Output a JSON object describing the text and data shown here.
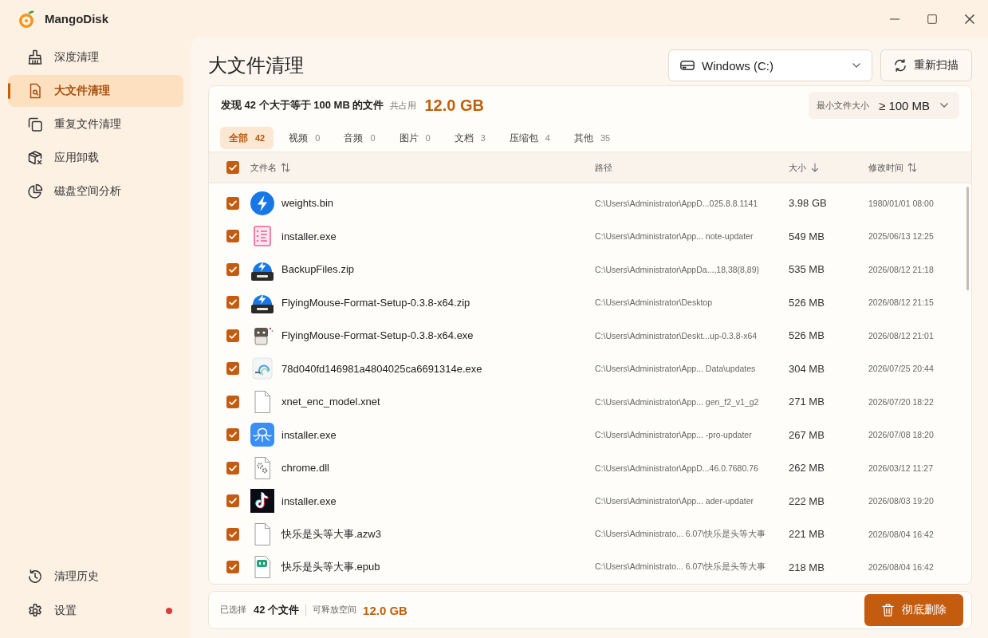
{
  "window": {
    "title": "MangoDisk"
  },
  "sidebar": {
    "items": [
      {
        "label": "深度清理",
        "selected": false
      },
      {
        "label": "大文件清理",
        "selected": true
      },
      {
        "label": "重复文件清理",
        "selected": false
      },
      {
        "label": "应用卸载",
        "selected": false
      },
      {
        "label": "磁盘空间分析",
        "selected": false
      }
    ],
    "bottom_items": [
      {
        "label": "清理历史",
        "notification": false
      },
      {
        "label": "设置",
        "notification": true
      }
    ]
  },
  "page": {
    "title": "大文件清理",
    "drive_select": {
      "value": "Windows (C:)"
    },
    "rescan_button": "重新扫描"
  },
  "summary": {
    "text": "发现 42 个大于等于 100 MB 的文件",
    "total_label": "共占用",
    "total": "12.0 GB",
    "min_size": {
      "label": "最小文件大小",
      "value": "≥ 100 MB"
    }
  },
  "tabs": [
    {
      "label": "全部",
      "count": "42",
      "selected": true
    },
    {
      "label": "视频",
      "count": "0",
      "selected": false
    },
    {
      "label": "音频",
      "count": "0",
      "selected": false
    },
    {
      "label": "图片",
      "count": "0",
      "selected": false
    },
    {
      "label": "文档",
      "count": "3",
      "selected": false
    },
    {
      "label": "压缩包",
      "count": "4",
      "selected": false
    },
    {
      "label": "其他",
      "count": "35",
      "selected": false
    }
  ],
  "table": {
    "all_checked": true,
    "columns": [
      {
        "label": "文件名",
        "sorted": false
      },
      {
        "label": "路径"
      },
      {
        "label": "大小",
        "sorted": true
      },
      {
        "label": "修改时间",
        "sorted": false
      }
    ],
    "rows": [
      {
        "checked": true,
        "name": "weights.bin",
        "path": "C:\\Users\\Administrator\\AppD...025.8.8.1141",
        "size": "3.98 GB",
        "modified": "1980/01/01 08:00"
      },
      {
        "checked": true,
        "name": "installer.exe",
        "path": "C:\\Users\\Administrator\\App... note-updater",
        "size": "549 MB",
        "modified": "2025/06/13 12:25"
      },
      {
        "checked": true,
        "name": "BackupFiles.zip",
        "path": "C:\\Users\\Administrator\\AppDa...,18,38(8,89)",
        "size": "535 MB",
        "modified": "2026/08/12 21:18"
      },
      {
        "checked": true,
        "name": "FlyingMouse-Format-Setup-0.3.8-x64.zip",
        "path": "C:\\Users\\Administrator\\Desktop",
        "size": "526 MB",
        "modified": "2026/08/12 21:15"
      },
      {
        "checked": true,
        "name": "FlyingMouse-Format-Setup-0.3.8-x64.exe",
        "path": "C:\\Users\\Administrator\\Deskt...up-0.3.8-x64",
        "size": "526 MB",
        "modified": "2026/08/12 21:01"
      },
      {
        "checked": true,
        "name": "78d040fd146981a4804025ca6691314e.exe",
        "path": "C:\\Users\\Administrator\\App... Data\\updates",
        "size": "304 MB",
        "modified": "2026/07/25 20:44"
      },
      {
        "checked": true,
        "name": "xnet_enc_model.xnet",
        "path": "C:\\Users\\Administrator\\App... gen_f2_v1_g2",
        "size": "271 MB",
        "modified": "2026/07/20 18:22"
      },
      {
        "checked": true,
        "name": "installer.exe",
        "path": "C:\\Users\\Administrator\\App... -pro-updater",
        "size": "267 MB",
        "modified": "2026/07/08 18:20"
      },
      {
        "checked": true,
        "name": "chrome.dll",
        "path": "C:\\Users\\Administrator\\AppD...46.0.7680.76",
        "size": "262 MB",
        "modified": "2026/03/12 11:27"
      },
      {
        "checked": true,
        "name": "installer.exe",
        "path": "C:\\Users\\Administrator\\App... ader-updater",
        "size": "222 MB",
        "modified": "2026/08/03 19:20"
      },
      {
        "checked": true,
        "name": "快乐是头等大事.azw3",
        "path": "C:\\Users\\Administrato... 6.07\\快乐是头等大事",
        "size": "221 MB",
        "modified": "2026/08/04 16:42"
      },
      {
        "checked": true,
        "name": "快乐是头等大事.epub",
        "path": "C:\\Users\\Administrato... 6.07\\快乐是头等大事",
        "size": "218 MB",
        "modified": "2026/08/04 16:42"
      }
    ]
  },
  "footer": {
    "selected_label": "已选择",
    "selected_count": "42 个文件",
    "free_label": "可释放空间",
    "free_value": "12.0 GB",
    "delete_button": "彻底删除"
  }
}
